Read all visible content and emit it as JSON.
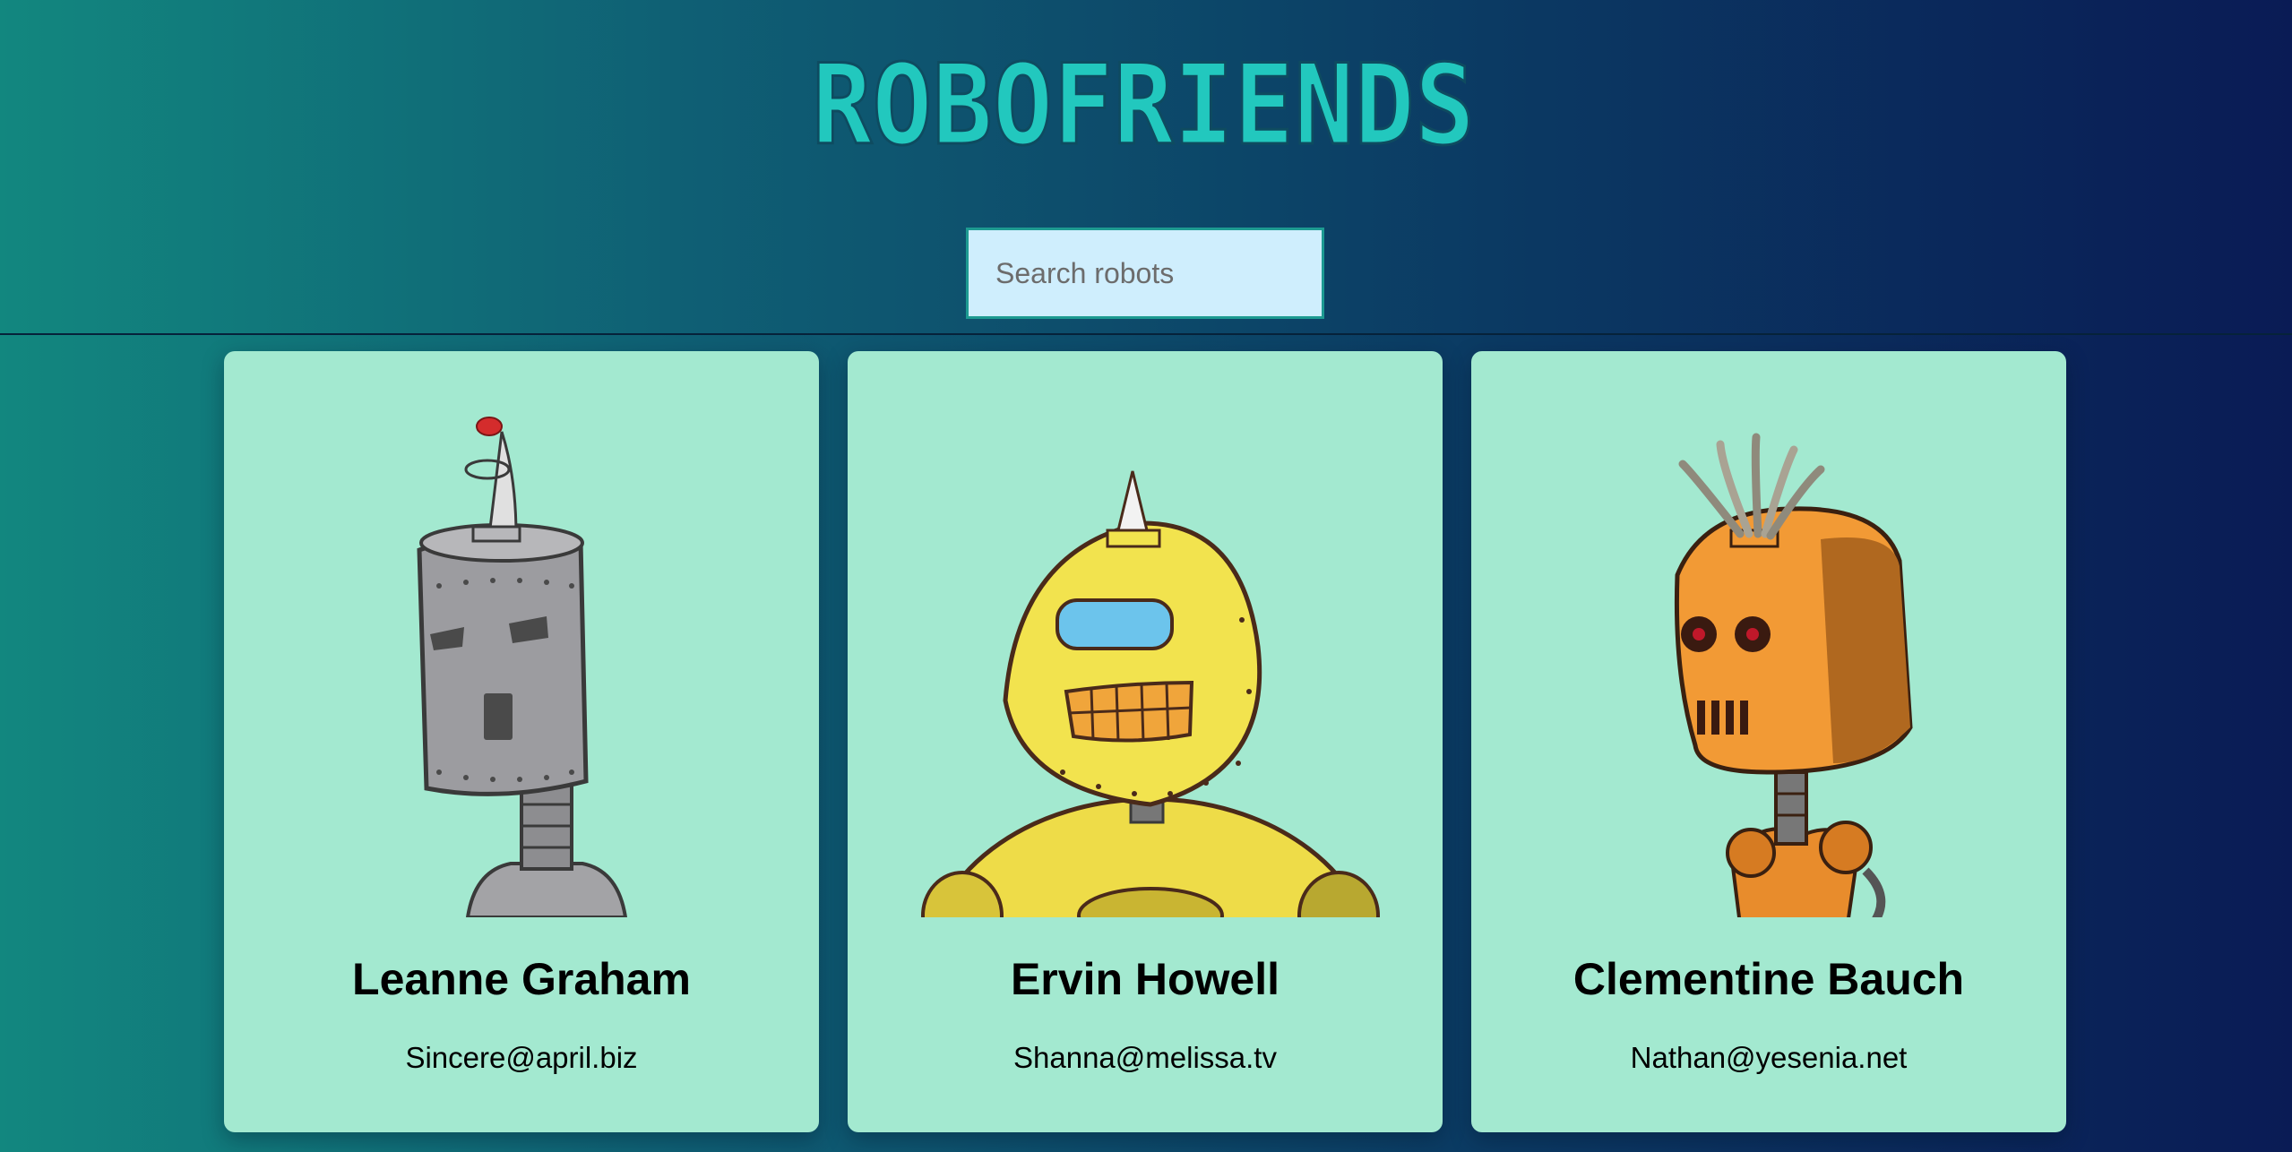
{
  "header": {
    "logo_text": "ROBOFRIENDS"
  },
  "search": {
    "placeholder": "Search robots"
  },
  "robots": [
    {
      "name": "Leanne Graham",
      "email": "Sincere@april.biz"
    },
    {
      "name": "Ervin Howell",
      "email": "Shanna@melissa.tv"
    },
    {
      "name": "Clementine Bauch",
      "email": "Nathan@yesenia.net"
    }
  ],
  "colors": {
    "logo": "#22c8be",
    "card": "#a3e9d0",
    "search_bg": "#cfeefd"
  }
}
